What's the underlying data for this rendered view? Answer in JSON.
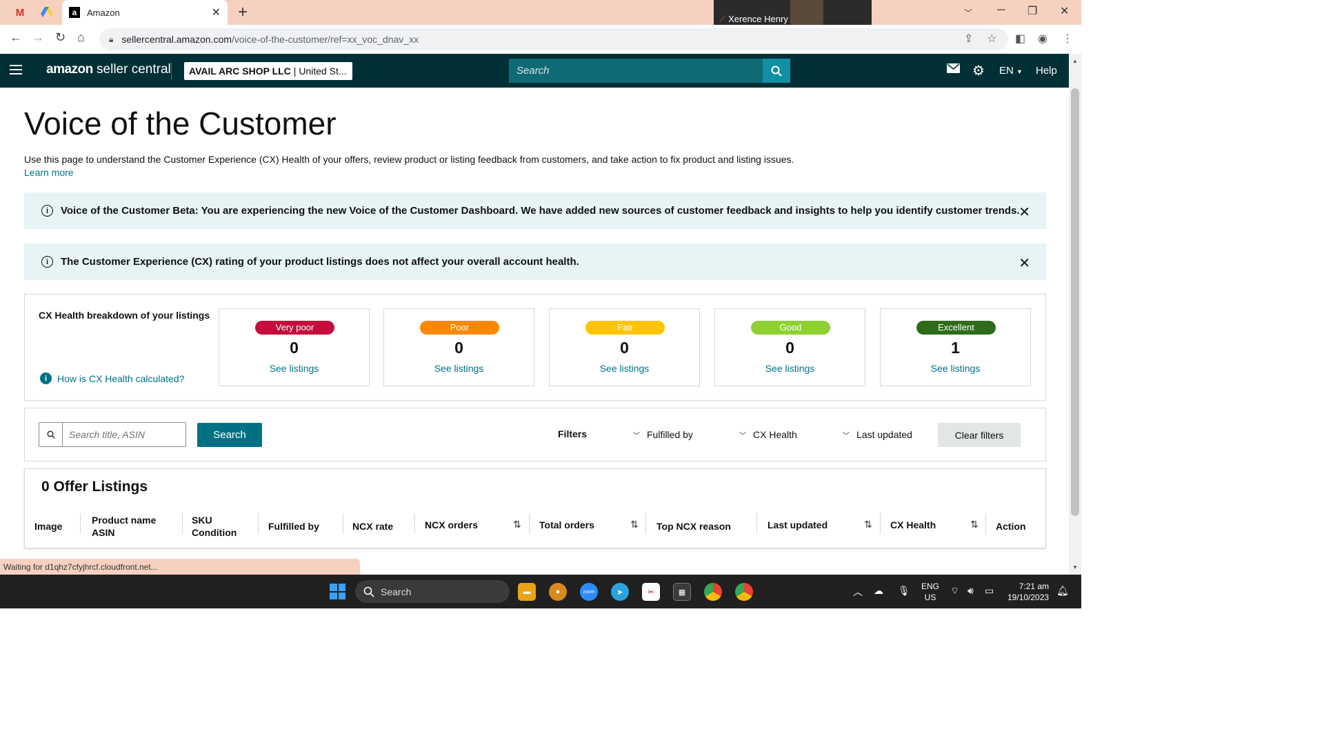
{
  "browser": {
    "tab_title": "Amazon",
    "video_name": "Xerence Henry",
    "url_host": "sellercentral.amazon.com",
    "url_path": "/voice-of-the-customer/ref=xx_voc_dnav_xx",
    "status_text": "Waiting for d1qhz7cfyjhrcf.cloudfront.net..."
  },
  "header": {
    "logo_brand": "amazon",
    "logo_suffix": " seller central",
    "account_name": "AVAIL ARC SHOP LLC",
    "account_region": "| United St...",
    "search_placeholder": "Search",
    "language": "EN",
    "help": "Help"
  },
  "page": {
    "title": "Voice of the Customer",
    "intro": "Use this page to understand the Customer Experience (CX) Health of your offers, review product or listing feedback from customers, and take action to fix product and listing issues.",
    "learn_more": "Learn more",
    "banner1": "Voice of the Customer Beta: You are experiencing the new Voice of the Customer Dashboard. We have added new sources of customer feedback and insights to help you identify customer trends.",
    "banner2": "The Customer Experience (CX) rating of your product listings does not affect your overall account health."
  },
  "cx": {
    "heading": "CX Health breakdown of your listings",
    "how_link": "How is CX Health calculated?",
    "cards": [
      {
        "label": "Very poor",
        "count": "0",
        "link": "See listings",
        "color": "#c40d3c"
      },
      {
        "label": "Poor",
        "count": "0",
        "link": "See listings",
        "color": "#fa8900"
      },
      {
        "label": "Fair",
        "count": "0",
        "link": "See listings",
        "color": "#ffc400"
      },
      {
        "label": "Good",
        "count": "0",
        "link": "See listings",
        "color": "#8fd132"
      },
      {
        "label": "Excellent",
        "count": "1",
        "link": "See listings",
        "color": "#2f6b1a"
      }
    ]
  },
  "filters": {
    "search_placeholder": "Search title, ASIN",
    "search_button": "Search",
    "filters_label": "Filters",
    "fulfilled_by": "Fulfilled by",
    "cx_health": "CX Health",
    "last_updated": "Last updated",
    "clear_filters": "Clear filters"
  },
  "offers": {
    "title": "0 Offer Listings",
    "columns": {
      "image": "Image",
      "product_name": "Product name",
      "asin": "ASIN",
      "sku": "SKU",
      "condition": "Condition",
      "fulfilled_by": "Fulfilled by",
      "ncx_rate": "NCX rate",
      "ncx_orders": "NCX orders",
      "total_orders": "Total orders",
      "top_ncx_reason": "Top NCX reason",
      "last_updated": "Last updated",
      "cx_health": "CX Health",
      "action": "Action"
    }
  },
  "taskbar": {
    "search": "Search",
    "lang_line1": "ENG",
    "lang_line2": "US",
    "time": "7:21 am",
    "date": "19/10/2023"
  }
}
